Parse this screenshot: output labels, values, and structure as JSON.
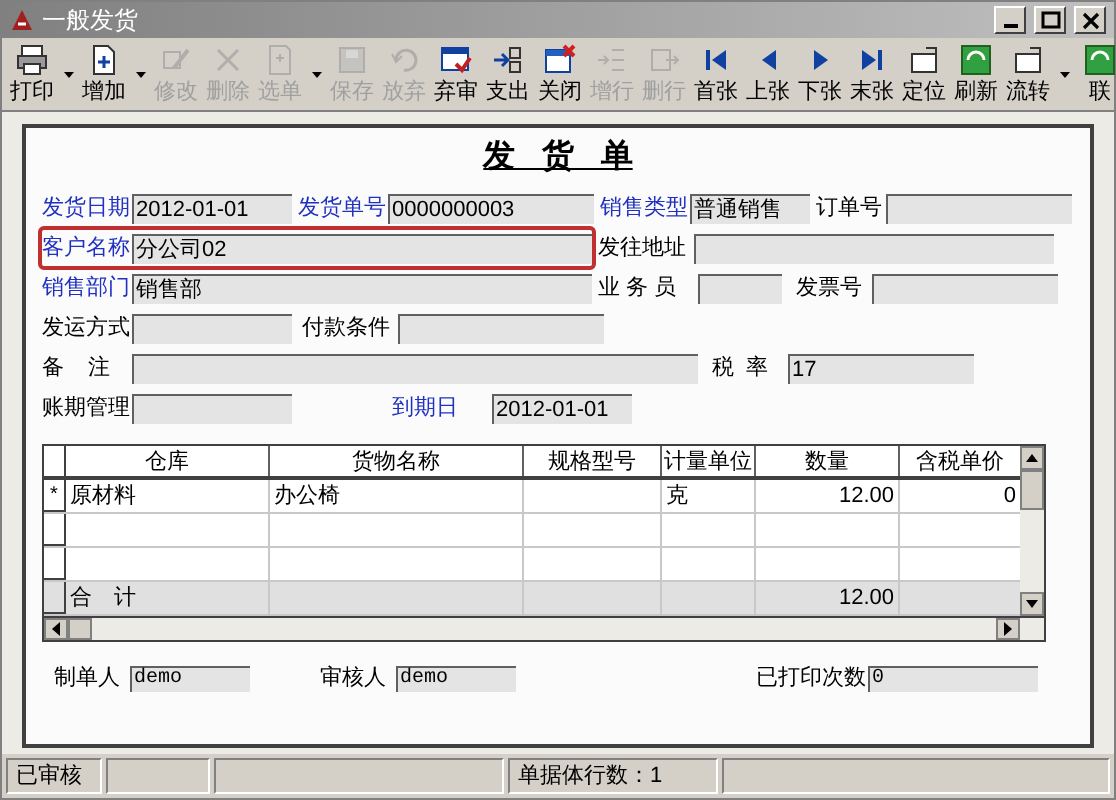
{
  "window": {
    "title": "一般发货"
  },
  "toolbar": [
    {
      "label": "打印",
      "disabled": false,
      "dropdown": true
    },
    {
      "label": "增加",
      "disabled": false,
      "dropdown": true
    },
    {
      "label": "修改",
      "disabled": true,
      "dropdown": false
    },
    {
      "label": "删除",
      "disabled": true,
      "dropdown": false
    },
    {
      "label": "选单",
      "disabled": true,
      "dropdown": true
    },
    {
      "label": "保存",
      "disabled": true,
      "dropdown": false
    },
    {
      "label": "放弃",
      "disabled": true,
      "dropdown": false
    },
    {
      "label": "弃审",
      "disabled": false,
      "dropdown": false
    },
    {
      "label": "支出",
      "disabled": false,
      "dropdown": false
    },
    {
      "label": "关闭",
      "disabled": false,
      "dropdown": false
    },
    {
      "label": "增行",
      "disabled": true,
      "dropdown": false
    },
    {
      "label": "删行",
      "disabled": true,
      "dropdown": false
    },
    {
      "label": "首张",
      "disabled": false,
      "dropdown": false
    },
    {
      "label": "上张",
      "disabled": false,
      "dropdown": false
    },
    {
      "label": "下张",
      "disabled": false,
      "dropdown": false
    },
    {
      "label": "末张",
      "disabled": false,
      "dropdown": false
    },
    {
      "label": "定位",
      "disabled": false,
      "dropdown": false
    },
    {
      "label": "刷新",
      "disabled": false,
      "dropdown": false
    },
    {
      "label": "流转",
      "disabled": false,
      "dropdown": true
    },
    {
      "label": "联",
      "disabled": false,
      "dropdown": false
    }
  ],
  "form": {
    "title": "发 货 单",
    "field_rows": [
      [
        {
          "label": "发货日期",
          "value": "2012-01-01",
          "required": true,
          "highlighted": false
        },
        {
          "label": "发货单号",
          "value": "0000000003",
          "required": true,
          "highlighted": false
        },
        {
          "label": "销售类型",
          "value": "普通销售",
          "required": true,
          "highlighted": false
        },
        {
          "label": "订单号",
          "required": false,
          "highlighted": false
        }
      ],
      [
        {
          "label": "客户名称",
          "value": "分公司02",
          "required": true,
          "highlighted": true
        },
        {
          "label": "发往地址",
          "required": false,
          "highlighted": false
        }
      ],
      [
        {
          "label": "销售部门",
          "value": "销售部",
          "required": true,
          "highlighted": false
        },
        {
          "label": "业 务 员",
          "required": false,
          "highlighted": false
        },
        {
          "label": "发票号",
          "required": false,
          "highlighted": false
        }
      ],
      [
        {
          "label": "发运方式",
          "required": false,
          "highlighted": false
        },
        {
          "label": "付款条件",
          "required": false,
          "highlighted": false
        }
      ],
      [
        {
          "label": "备    注",
          "required": false,
          "highlighted": false
        },
        {
          "label": "税  率",
          "value": "17",
          "required": false,
          "highlighted": false
        }
      ],
      [
        {
          "label": "账期管理",
          "required": false,
          "highlighted": false
        },
        {
          "label": "到期日",
          "value": "2012-01-01",
          "required": true,
          "highlighted": false
        }
      ]
    ],
    "table": {
      "columns": [
        "仓库",
        "货物名称",
        "规格型号",
        "计量单位",
        "数量",
        "含税单价"
      ],
      "rows": [
        {
          "marker": "*",
          "cells": [
            "原材料",
            "办公椅",
            "",
            "克",
            "12.00",
            "0"
          ]
        }
      ],
      "total": {
        "label": "合　计",
        "cells": [
          "",
          "",
          "",
          "12.00",
          ""
        ]
      }
    },
    "footer": [
      {
        "label": "制单人",
        "value": "demo"
      },
      {
        "label": "审核人",
        "value": "demo"
      },
      {
        "label": "已打印次数",
        "value": "0"
      }
    ]
  },
  "status_bar": [
    "已审核",
    "单据体行数：1"
  ]
}
